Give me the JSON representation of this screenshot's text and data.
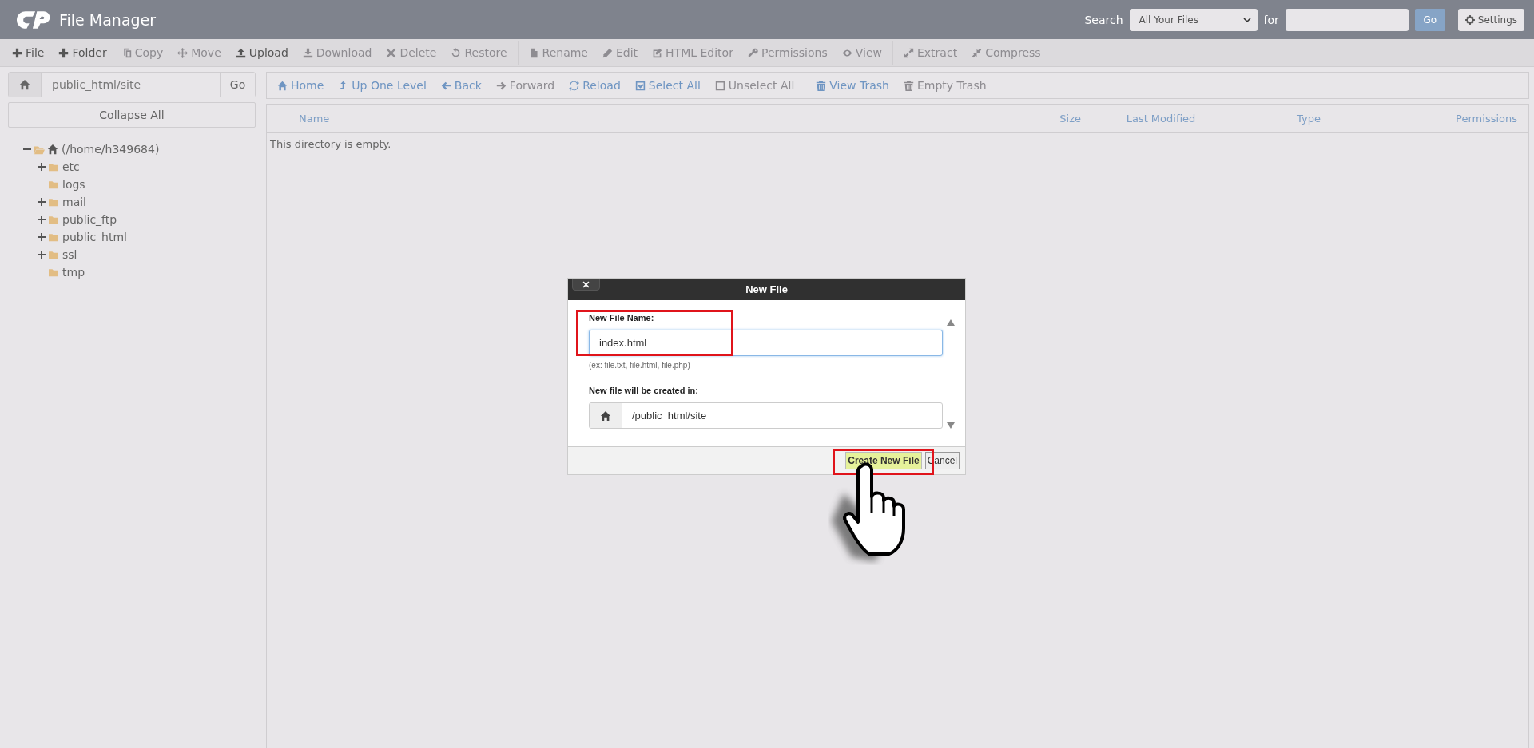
{
  "header": {
    "title": "File Manager",
    "search_label": "Search",
    "search_scope": "All Your Files",
    "for_label": "for",
    "go": "Go",
    "settings": "Settings"
  },
  "toolbar": [
    {
      "label": "File",
      "disabled": false
    },
    {
      "label": "Folder",
      "disabled": false
    },
    {
      "label": "Copy",
      "disabled": true
    },
    {
      "label": "Move",
      "disabled": true
    },
    {
      "label": "Upload",
      "disabled": false
    },
    {
      "label": "Download",
      "disabled": true
    },
    {
      "label": "Delete",
      "disabled": true
    },
    {
      "label": "Restore",
      "disabled": true
    },
    {
      "label": "Rename",
      "disabled": true
    },
    {
      "label": "Edit",
      "disabled": true
    },
    {
      "label": "HTML Editor",
      "disabled": true
    },
    {
      "label": "Permissions",
      "disabled": true
    },
    {
      "label": "View",
      "disabled": true
    },
    {
      "label": "Extract",
      "disabled": true
    },
    {
      "label": "Compress",
      "disabled": true
    }
  ],
  "path_bar": {
    "value": "public_html/site",
    "go": "Go"
  },
  "collapse_all": "Collapse All",
  "tree": [
    {
      "label": "(/home/h349684)",
      "expanded": true,
      "children": [
        {
          "label": "etc",
          "expanded": false
        },
        {
          "label": "logs"
        },
        {
          "label": "mail",
          "expanded": false
        },
        {
          "label": "public_ftp",
          "expanded": false
        },
        {
          "label": "public_html",
          "expanded": false
        },
        {
          "label": "ssl",
          "expanded": false
        },
        {
          "label": "tmp"
        }
      ]
    }
  ],
  "nav": [
    {
      "label": "Home",
      "disabled": false
    },
    {
      "label": "Up One Level",
      "disabled": false
    },
    {
      "label": "Back",
      "disabled": false
    },
    {
      "label": "Forward",
      "disabled": true
    },
    {
      "label": "Reload",
      "disabled": false
    },
    {
      "label": "Select All",
      "disabled": false
    },
    {
      "label": "Unselect All",
      "disabled": true
    },
    {
      "label": "View Trash",
      "disabled": false
    },
    {
      "label": "Empty Trash",
      "disabled": true
    }
  ],
  "table": {
    "columns": [
      "Name",
      "Size",
      "Last Modified",
      "Type",
      "Permissions"
    ],
    "empty_message": "This directory is empty."
  },
  "dialog": {
    "title": "New File",
    "name_label": "New File Name:",
    "name_value": "index.html",
    "name_hint": "(ex: file.txt, file.html, file.php)",
    "location_label": "New file will be created in:",
    "location_value": "/public_html/site",
    "buttons": [
      "Create New File",
      "Cancel"
    ]
  }
}
